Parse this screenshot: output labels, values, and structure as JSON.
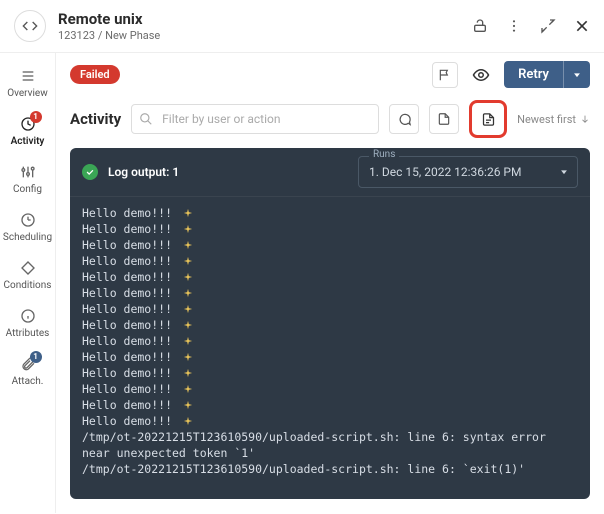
{
  "header": {
    "title": "Remote unix",
    "subtitle_id": "123123",
    "subtitle_sep": " / ",
    "subtitle_phase": "New Phase"
  },
  "sidebar": {
    "items": {
      "overview": "Overview",
      "activity": "Activity",
      "config": "Config",
      "scheduling": "Scheduling",
      "conditions": "Conditions",
      "attributes": "Attributes",
      "attach": "Attach."
    },
    "activity_badge": "1",
    "attach_badge": "1"
  },
  "status": {
    "failed": "Failed",
    "retry": "Retry"
  },
  "activity": {
    "heading": "Activity",
    "search_placeholder": "Filter by user or action",
    "sort_label": "Newest first"
  },
  "console": {
    "log_label": "Log output: 1",
    "runs_legend": "Runs",
    "runs_selected": "1. Dec 15, 2022 12:36:26 PM",
    "hello_line": "Hello demo!!!",
    "hello_repeat": 14,
    "error_line_1": "/tmp/ot-20221215T123610590/uploaded-script.sh: line 6: syntax error near unexpected token `1'",
    "error_line_2": "/tmp/ot-20221215T123610590/uploaded-script.sh: line 6: `exit(1)'"
  }
}
